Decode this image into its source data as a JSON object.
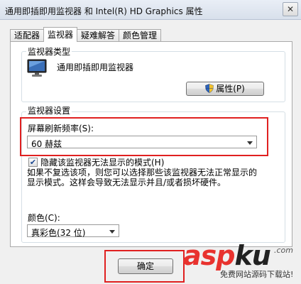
{
  "window": {
    "title": "通用即插即用监视器 和 Intel(R) HD Graphics 属性",
    "close_glyph": "✕"
  },
  "tabs": [
    {
      "label": "适配器",
      "active": false
    },
    {
      "label": "监视器",
      "active": true
    },
    {
      "label": "疑难解答",
      "active": false
    },
    {
      "label": "颜色管理",
      "active": false
    }
  ],
  "monitor_type": {
    "heading": "监视器类型",
    "name": "通用即插即用监视器",
    "icon": "monitor-icon",
    "properties_button": "属性(P)"
  },
  "monitor_settings": {
    "heading": "监视器设置",
    "refresh_label": "屏幕刷新频率(S):",
    "refresh_value": "60 赫兹",
    "hide_modes_checked": true,
    "hide_modes_label": "隐藏该监视器无法显示的模式(H)",
    "hint_text": "如果不复选该项，则您可以选择那些该监视器无法正常显示的显示模式。这样会导致无法显示并且/或者损坏硬件。",
    "color_label": "颜色(C):",
    "color_value": "真彩色(32 位)"
  },
  "footer": {
    "ok_button": "确定"
  },
  "watermark": {
    "logo_red": "asp",
    "logo_dark": "ku",
    "logo_suffix": ".com",
    "tagline": "免费网站源码下载站!"
  },
  "colors": {
    "highlight_box": "#e02020",
    "tab_border": "#a9a9a9",
    "panel_bg": "#f0f0f0"
  }
}
